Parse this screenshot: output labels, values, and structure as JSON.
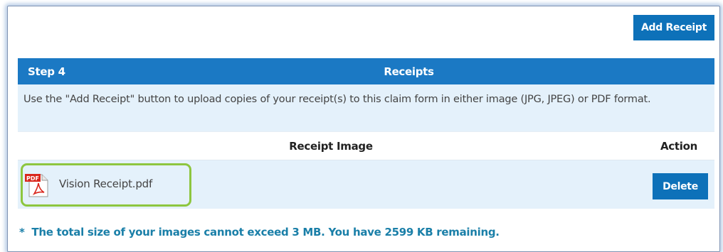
{
  "toolbar": {
    "add_receipt_label": "Add Receipt"
  },
  "section": {
    "step_label": "Step 4",
    "title": "Receipts",
    "instructions": "Use the \"Add Receipt\" button to upload copies of your receipt(s) to this claim form in either image (JPG, JPEG) or PDF format."
  },
  "table": {
    "columns": [
      "Receipt Image",
      "Action"
    ],
    "rows": [
      {
        "file_name": "Vision Receipt.pdf",
        "file_icon": "pdf-file-icon",
        "icon_badge": "PDF",
        "action_label": "Delete"
      }
    ]
  },
  "footer": {
    "asterisk": "*",
    "note": "The total size of your images cannot exceed 3 MB. You have 2599 KB remaining."
  },
  "colors": {
    "primary_button": "#0d71b9",
    "header_bg": "#1b79c4",
    "row_bg": "#e4f1fb",
    "highlight_border": "#8dc63f",
    "note_text": "#1a7fa8"
  }
}
